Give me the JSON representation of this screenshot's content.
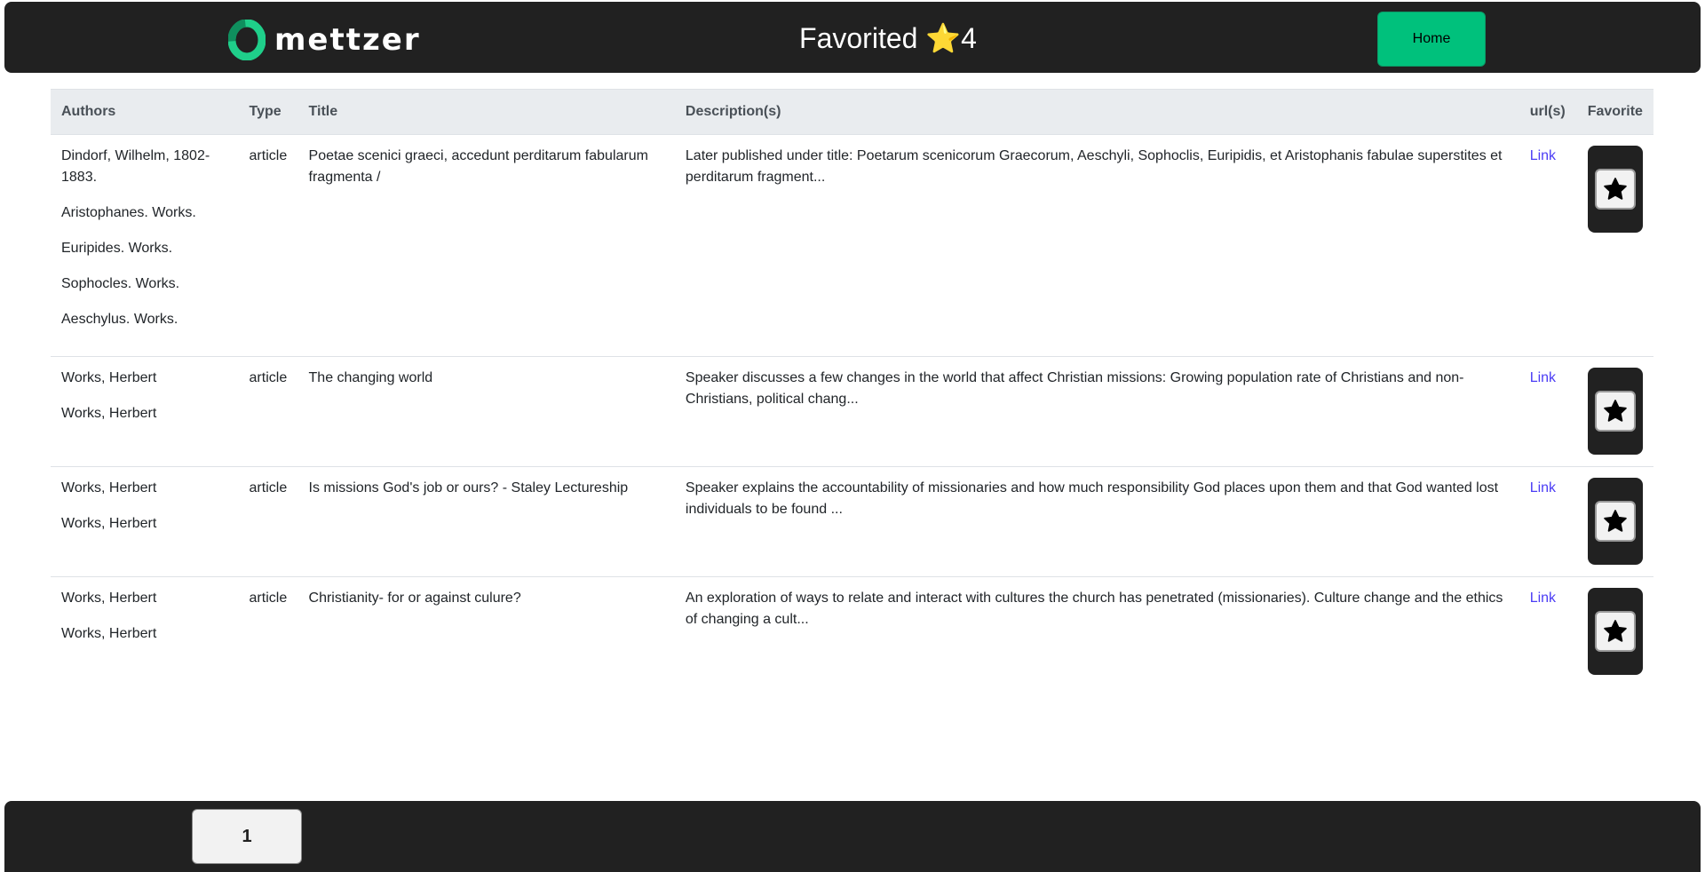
{
  "header": {
    "brand": "mettzer",
    "title": "Favorited",
    "title_icon": "⭐",
    "favorite_count": "4",
    "home_label": "Home"
  },
  "table": {
    "columns": [
      "Authors",
      "Type",
      "Title",
      "Description(s)",
      "url(s)",
      "Favorite"
    ],
    "rows": [
      {
        "authors": [
          "Dindorf, Wilhelm, 1802-1883.",
          "Aristophanes. Works.",
          "Euripides. Works.",
          "Sophocles. Works.",
          "Aeschylus. Works."
        ],
        "type": "article",
        "title": "Poetae scenici graeci, accedunt perditarum fabularum fragmenta /",
        "description": "Later published under title: Poetarum scenicorum Graecorum, Aeschyli, Sophoclis, Euripidis, et Aristophanis fabulae superstites et perditarum fragment...",
        "url_label": "Link"
      },
      {
        "authors": [
          "Works, Herbert",
          "Works, Herbert"
        ],
        "type": "article",
        "title": "The changing world",
        "description": "Speaker discusses a few changes in the world that affect Christian missions: Growing population rate of Christians and non-Christians, political chang...",
        "url_label": "Link"
      },
      {
        "authors": [
          "Works, Herbert",
          "Works, Herbert"
        ],
        "type": "article",
        "title": "Is missions God's job or ours? - Staley Lectureship",
        "description": "Speaker explains the accountability of missionaries and how much responsibility God places upon them and that God wanted lost individuals to be found ...",
        "url_label": "Link"
      },
      {
        "authors": [
          "Works, Herbert",
          "Works, Herbert"
        ],
        "type": "article",
        "title": "Christianity- for or against culure?",
        "description": "An exploration of ways to relate and interact with cultures the church has penetrated (missionaries). Culture change and the ethics of changing a cult...",
        "url_label": "Link"
      }
    ]
  },
  "pagination": {
    "current_page": "1"
  },
  "colors": {
    "bar_bg": "#212121",
    "accent_green": "#00c17c",
    "link": "#4b3cf5",
    "table_header_bg": "#e9ecef"
  },
  "icons": {
    "favorite": "star-icon",
    "brand": "mettzer-logo-ring-icon"
  }
}
